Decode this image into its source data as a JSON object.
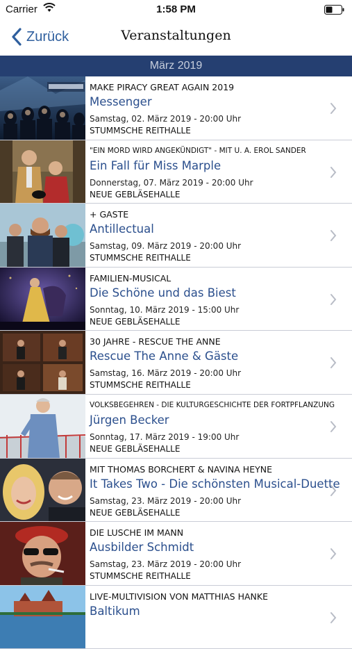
{
  "status": {
    "carrier": "Carrier",
    "time": "1:58 PM"
  },
  "nav": {
    "back_label": "Zurück",
    "title": "Veranstaltungen"
  },
  "section": {
    "title": "März 2019"
  },
  "events": [
    {
      "subtitle": "MAKE PIRACY GREAT AGAIN 2019",
      "title": "Messenger",
      "date": "Samstag, 02. März 2019 - 20:00 Uhr",
      "venue": "STUMMSCHE REITHALLE",
      "image": "messenger-band-photo"
    },
    {
      "subtitle": "\"EIN MORD WIRD ANGEKÜNDIGT\" - MIT U. A. EROL SANDER",
      "title": "Ein Fall für Miss Marple",
      "date": "Donnerstag, 07. März 2019 - 20:00 Uhr",
      "venue": "NEUE GEBLÄSEHALLE",
      "image": "miss-marple-cast-photo"
    },
    {
      "subtitle": "+ GASTE",
      "title": "Antillectual",
      "date": "Samstag, 09. März 2019 - 20:00 Uhr",
      "venue": "STUMMSCHE REITHALLE",
      "image": "antillectual-band-photo"
    },
    {
      "subtitle": "FAMILIEN-MUSICAL",
      "title": "Die Schöne und das Biest",
      "date": "Sonntag, 10. März 2019 - 15:00 Uhr",
      "venue": "NEUE GEBLÄSEHALLE",
      "image": "musical-stage-photo"
    },
    {
      "subtitle": "30 JAHRE - RESCUE THE ANNE",
      "title": "Rescue The Anne & Gäste",
      "date": "Samstag, 16. März 2019 - 20:00 Uhr",
      "venue": "STUMMSCHE REITHALLE",
      "image": "band-collage-photo"
    },
    {
      "subtitle": "VOLKSBEGEHREN - DIE KULTURGESCHICHTE DER FORTPFLANZUNG",
      "title": "Jürgen Becker",
      "date": "Sonntag, 17. März 2019 - 19:00 Uhr",
      "venue": "NEUE GEBLÄSEHALLE",
      "image": "comedian-photo"
    },
    {
      "subtitle": "MIT THOMAS BORCHERT & NAVINA HEYNE",
      "title": "It Takes Two - Die schönsten Musical-Duette",
      "date": "Samstag, 23. März 2019 - 20:00 Uhr",
      "venue": "NEUE GEBLÄSEHALLE",
      "image": "duo-singers-photo"
    },
    {
      "subtitle": "DIE LUSCHE IM MANN",
      "title": "Ausbilder Schmidt",
      "date": "Samstag, 23. März 2019 - 20:00 Uhr",
      "venue": "STUMMSCHE REITHALLE",
      "image": "ausbilder-schmidt-photo"
    },
    {
      "subtitle": "LIVE-MULTIVISION VON MATTHIAS HANKE",
      "title": "Baltikum",
      "date": "",
      "venue": "",
      "image": "castle-landscape-photo"
    }
  ],
  "colors": {
    "accent": "#2b4f8d",
    "section_bg": "#253f71",
    "section_text": "#c8cfdd"
  }
}
